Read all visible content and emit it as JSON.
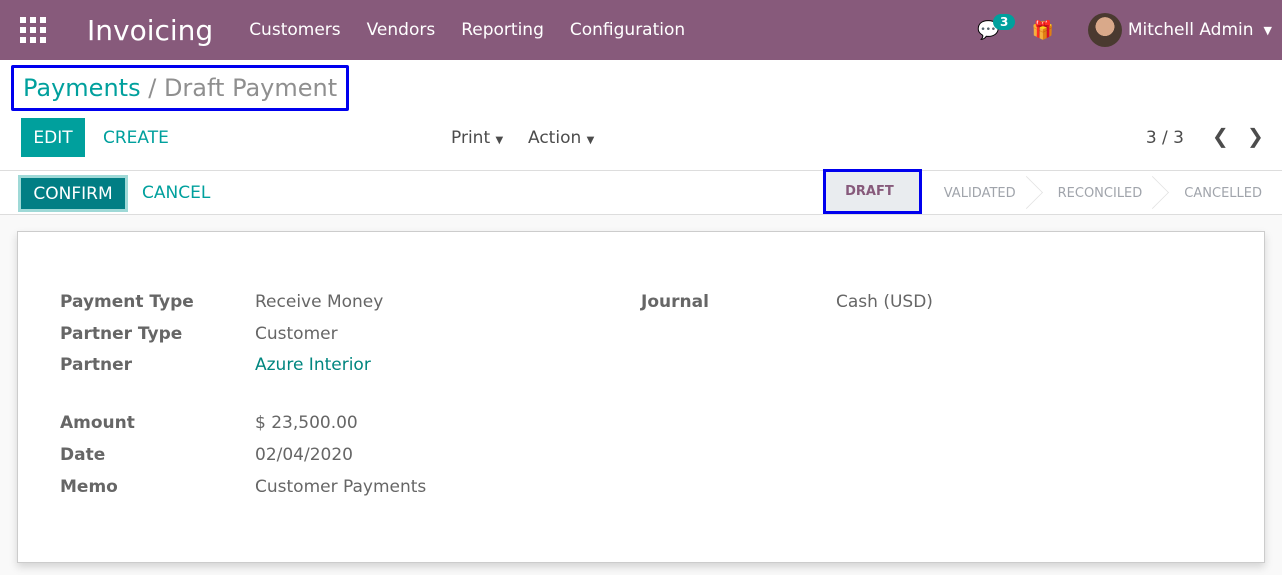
{
  "navbar": {
    "app_title": "Invoicing",
    "menu": [
      "Customers",
      "Vendors",
      "Reporting",
      "Configuration"
    ],
    "message_count": "3",
    "user": "Mitchell Admin",
    "color": "#875A7B"
  },
  "breadcrumb": {
    "parent": "Payments",
    "separator": "/",
    "current": "Draft Payment"
  },
  "toolbar": {
    "edit": "EDIT",
    "create": "CREATE",
    "print": "Print",
    "action": "Action",
    "pager": "3 / 3"
  },
  "statusbar": {
    "confirm": "CONFIRM",
    "cancel": "CANCEL",
    "steps": [
      "DRAFT",
      "VALIDATED",
      "RECONCILED",
      "CANCELLED"
    ],
    "active": "DRAFT"
  },
  "form": {
    "payment_type": {
      "label": "Payment Type",
      "value": "Receive Money"
    },
    "partner_type": {
      "label": "Partner Type",
      "value": "Customer"
    },
    "partner": {
      "label": "Partner",
      "value": "Azure Interior"
    },
    "amount": {
      "label": "Amount",
      "value": "$ 23,500.00"
    },
    "date": {
      "label": "Date",
      "value": "02/04/2020"
    },
    "memo": {
      "label": "Memo",
      "value": "Customer Payments"
    },
    "journal": {
      "label": "Journal",
      "value": "Cash (USD)"
    }
  },
  "colors": {
    "primary": "#00A09D",
    "confirm": "#017e84"
  }
}
